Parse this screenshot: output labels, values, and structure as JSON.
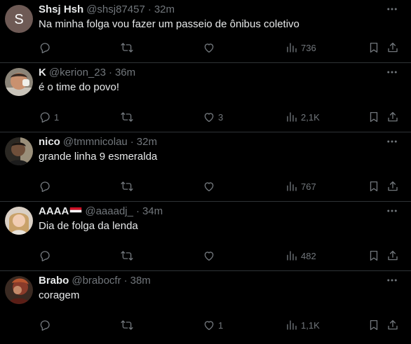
{
  "tweets": [
    {
      "name": "Shsj Hsh",
      "handle": "@shsj87457",
      "time": "32m",
      "text": "Na minha folga vou fazer um passeio de ônibus coletivo",
      "avatar_letter": "S",
      "replies": "",
      "retweets": "",
      "likes": "",
      "views": "736"
    },
    {
      "name": "K",
      "handle": "@kerion_23",
      "time": "36m",
      "text": "é o time do povo!",
      "replies": "1",
      "retweets": "",
      "likes": "3",
      "views": "2,1K"
    },
    {
      "name": "nico",
      "handle": "@tmmnicolau",
      "time": "32m",
      "text": "grande linha 9 esmeralda",
      "replies": "",
      "retweets": "",
      "likes": "",
      "views": "767"
    },
    {
      "name": "AAAA",
      "handle": "@aaaadj_",
      "time": "34m",
      "text": "Dia de folga da lenda",
      "replies": "",
      "retweets": "",
      "likes": "",
      "views": "482"
    },
    {
      "name": "Brabo",
      "handle": "@brabocfr",
      "time": "38m",
      "text": "coragem",
      "replies": "",
      "retweets": "",
      "likes": "1",
      "views": "1,1K"
    }
  ],
  "separator": "·",
  "colors": {
    "background": "#000000",
    "text": "#e7e9ea",
    "muted": "#71767b",
    "divider": "#2f3336"
  },
  "icons": [
    "more-icon",
    "reply-icon",
    "retweet-icon",
    "like-icon",
    "views-icon",
    "bookmark-icon",
    "share-icon"
  ]
}
